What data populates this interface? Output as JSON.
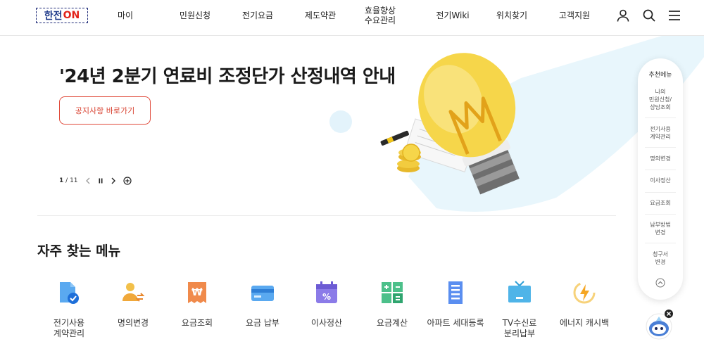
{
  "logo": {
    "text_a": "한전",
    "text_b": "ON"
  },
  "nav": {
    "items": [
      {
        "label": "마이"
      },
      {
        "label": "민원신청"
      },
      {
        "label": "전기요금"
      },
      {
        "label": "제도약관"
      },
      {
        "label": "효율향상\n수요관리"
      },
      {
        "label": "전기Wiki"
      },
      {
        "label": "위치찾기"
      },
      {
        "label": "고객지원"
      }
    ],
    "icons": [
      "user-icon",
      "search-icon",
      "menu-icon"
    ]
  },
  "hero": {
    "title": "'24년 2분기 연료비 조정단가 산정내역 안내",
    "button_label": "공지사항 바로가기",
    "pager_current": "1",
    "pager_separator": "/",
    "pager_total": "11"
  },
  "frequent": {
    "title": "자주 찾는 메뉴",
    "items": [
      {
        "label": "전기사용\n계약관리",
        "icon": "document-check-icon"
      },
      {
        "label": "명의변경",
        "icon": "user-change-icon"
      },
      {
        "label": "요금조회",
        "icon": "won-receipt-icon"
      },
      {
        "label": "요금 납부",
        "icon": "card-icon"
      },
      {
        "label": "이사정산",
        "icon": "calendar-percent-icon"
      },
      {
        "label": "요금계산",
        "icon": "calculator-icon"
      },
      {
        "label": "아파트 세대등록",
        "icon": "apartment-icon"
      },
      {
        "label": "TV수신료\n분리납부",
        "icon": "tv-icon"
      },
      {
        "label": "에너지 캐시백",
        "icon": "energy-icon"
      }
    ]
  },
  "side_menu": {
    "title": "추천메뉴",
    "items": [
      {
        "label": "나의\n민원신청/\n상담조회"
      },
      {
        "label": "전기사용\n계약관리"
      },
      {
        "label": "명의변경"
      },
      {
        "label": "이사정산"
      },
      {
        "label": "요금조회"
      },
      {
        "label": "납부방법\n변경"
      },
      {
        "label": "청구서\n변경"
      }
    ]
  },
  "colors": {
    "brand_blue": "#1e3a8a",
    "brand_red": "#e2231a",
    "button_red": "#d8402f",
    "hero_bg_blue": "#e8f6fc",
    "bulb_yellow": "#f6d64a"
  }
}
